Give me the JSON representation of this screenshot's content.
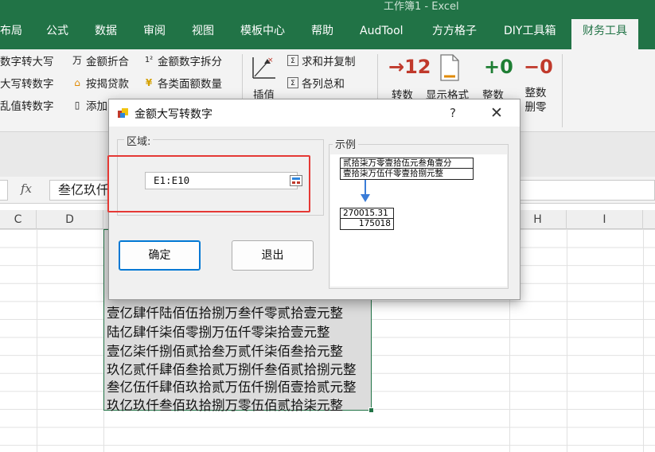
{
  "window": {
    "title": "工作簿1  -  Excel"
  },
  "ribbon_tabs": [
    {
      "label": "布局"
    },
    {
      "label": "公式"
    },
    {
      "label": "数据"
    },
    {
      "label": "审阅"
    },
    {
      "label": "视图"
    },
    {
      "label": "模板中心"
    },
    {
      "label": "帮助"
    },
    {
      "label": "AudTool"
    },
    {
      "label": "方方格子"
    },
    {
      "label": "DIY工具箱"
    },
    {
      "label": "财务工具"
    }
  ],
  "ribbon": {
    "col1": [
      "数字转大写",
      "大写转数字",
      "乱值转数字"
    ],
    "col2": [
      "金额折合",
      "按揭贷款",
      "添加"
    ],
    "col3": [
      "金额数字拆分",
      "各类面额数量"
    ],
    "insert_label": "插值",
    "col4": [
      "求和并复制",
      "各列总和"
    ],
    "big": [
      {
        "num": "→12",
        "label": "转数",
        "color": "#c0392b"
      },
      {
        "num": "",
        "label": "显示格式",
        "color": "#777777"
      },
      {
        "num": "+0",
        "label": "整数",
        "color": "#1e7e34"
      },
      {
        "num": "−0",
        "label": "整数删零",
        "color": "#c0392b"
      }
    ]
  },
  "formula_bar": {
    "fx": "fx",
    "value": "叁亿玖仟"
  },
  "columns": [
    "C",
    "D",
    "",
    "",
    "",
    "",
    "H",
    "I"
  ],
  "cells": [
    "壹亿肆仟陆佰伍拾捌万叁仟零贰拾壹元整",
    "陆亿肆仟柒佰零捌万伍仟零柒拾壹元整",
    "壹亿柒仟捌佰贰拾叁万贰仟柒佰叁拾元整",
    "玖亿贰仟肆佰叁拾贰万捌仟叁佰贰拾捌元整",
    "叁亿伍仟肆佰玖拾贰万伍仟捌佰壹拾贰元整",
    "玖亿玖仟叁佰玖拾捌万零伍佰贰拾柒元整"
  ],
  "dialog": {
    "title": "金额大写转数字",
    "help": "?",
    "close": "✕",
    "area_label": "区域:",
    "range_value": "E1:E10",
    "ok_label": "确定",
    "exit_label": "退出",
    "example_label": "示例",
    "example": {
      "upper": [
        "贰拾柒万零壹拾伍元叁角壹分",
        "壹拾柒万伍仟零壹拾捌元整"
      ],
      "numbers": [
        "270015.31",
        "175018"
      ]
    }
  },
  "colors": {
    "excel_green": "#217346",
    "selection_border": "#217346",
    "highlight_red": "#e53935",
    "accent_blue": "#0078d4"
  }
}
